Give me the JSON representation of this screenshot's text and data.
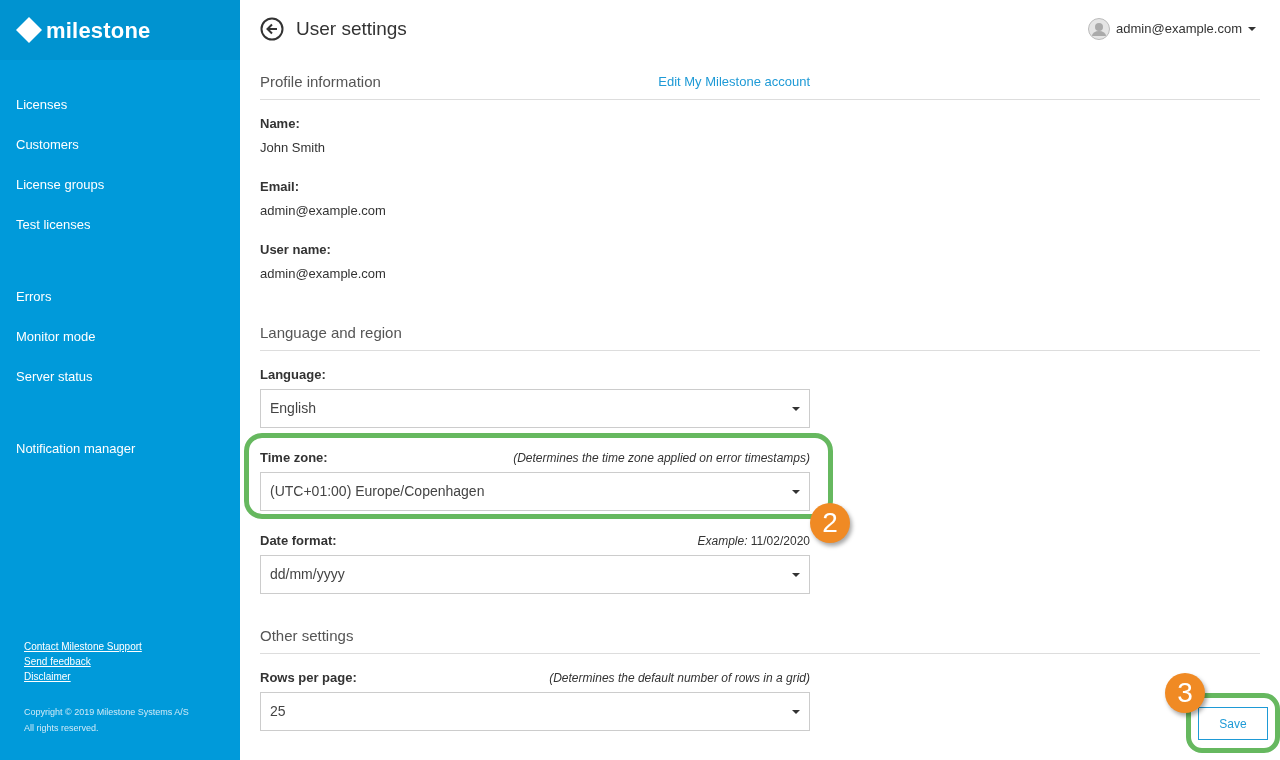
{
  "sidebar": {
    "logo": "milestone",
    "nav_groups": [
      [
        {
          "label": "Licenses"
        },
        {
          "label": "Customers"
        },
        {
          "label": "License groups"
        },
        {
          "label": "Test licenses"
        }
      ],
      [
        {
          "label": "Errors"
        },
        {
          "label": "Monitor mode"
        },
        {
          "label": "Server status"
        }
      ],
      [
        {
          "label": "Notification manager"
        }
      ]
    ],
    "footer_links": [
      "Contact Milestone Support",
      "Send feedback",
      "Disclaimer"
    ],
    "copyright": [
      "Copyright © 2019 Milestone Systems A/S",
      "All rights reserved."
    ]
  },
  "header": {
    "title": "User settings",
    "user": "admin@example.com"
  },
  "sections": [
    {
      "title": "Profile information",
      "link": "Edit My Milestone account",
      "fields": [
        {
          "kind": "text",
          "label": "Name:",
          "value": "John Smith"
        },
        {
          "kind": "text",
          "label": "Email:",
          "value": "admin@example.com"
        },
        {
          "kind": "text",
          "label": "User name:",
          "value": "admin@example.com"
        }
      ]
    },
    {
      "title": "Language and region",
      "fields": [
        {
          "kind": "select",
          "label": "Language:",
          "value": "English"
        },
        {
          "kind": "select",
          "label": "Time zone:",
          "hint": "(Determines the time zone applied on error timestamps)",
          "hint_italic": true,
          "value": "(UTC+01:00) Europe/Copenhagen",
          "callout": "2"
        },
        {
          "kind": "select",
          "label": "Date format:",
          "hint": "*Example:* 11/02/2020",
          "hint_italic": false,
          "value": "dd/mm/yyyy"
        }
      ]
    },
    {
      "title": "Other settings",
      "fields": [
        {
          "kind": "select",
          "label": "Rows per page:",
          "hint": "(Determines the default number of rows in a grid)",
          "hint_italic": true,
          "value": "25"
        }
      ]
    }
  ],
  "save": {
    "label": "Save",
    "callout": "3"
  }
}
